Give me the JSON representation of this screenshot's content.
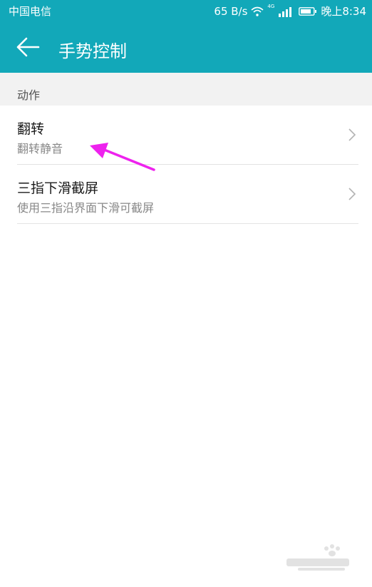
{
  "status_bar": {
    "carrier": "中国电信",
    "speed": "65 B/s",
    "network_tag": "4G",
    "time": "晚上8:34"
  },
  "header": {
    "title": "手势控制"
  },
  "section": {
    "label": "动作"
  },
  "items": [
    {
      "title": "翻转",
      "subtitle": "翻转静音"
    },
    {
      "title": "三指下滑截屏",
      "subtitle": "使用三指沿界面下滑可截屏"
    }
  ],
  "colors": {
    "header_bg": "#12a8b9",
    "annotation_arrow": "#ee22ee"
  },
  "icons": {
    "back": "arrow-left-icon",
    "chevron": "chevron-right-icon",
    "wifi": "wifi-icon",
    "signal": "signal-icon",
    "battery": "battery-icon"
  }
}
